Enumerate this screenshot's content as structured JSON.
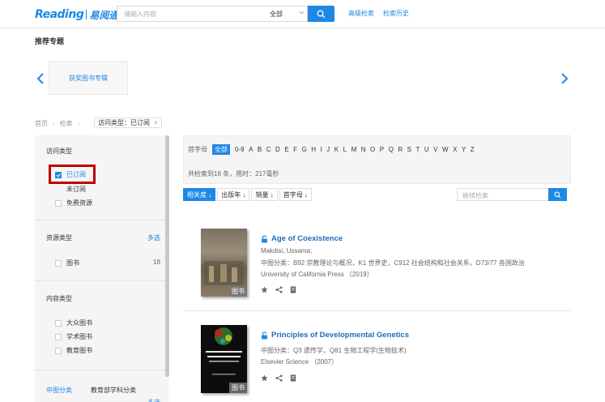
{
  "header": {
    "logo_en": "Reading",
    "logo_cn": "易阅通",
    "search_placeholder": "请输入内容",
    "search_scope": "全部",
    "advanced_search": "高级检索",
    "search_history": "检索历史"
  },
  "featured": {
    "title": "推荐专题",
    "card_label": "获奖图书专辑"
  },
  "breadcrumb": {
    "home": "首页",
    "search": "检索",
    "filter_tag": "访问类型：已订阅"
  },
  "sidebar": {
    "access": {
      "title": "访问类型",
      "items": [
        {
          "label": "已订阅",
          "checked": true
        },
        {
          "label": "未订阅",
          "checked": false
        },
        {
          "label": "免费资源",
          "checked": false
        }
      ]
    },
    "resource": {
      "title": "资源类型",
      "more": "多选",
      "items": [
        {
          "label": "图书",
          "count": "18"
        }
      ]
    },
    "content": {
      "title": "内容类型",
      "items": [
        {
          "label": "大众图书"
        },
        {
          "label": "学术图书"
        },
        {
          "label": "教育图书"
        }
      ]
    },
    "bottom_tabs": [
      "中图分类",
      "教育部学科分类"
    ],
    "bottom_more": "多选"
  },
  "letters": {
    "label": "首字母",
    "items": [
      "全部",
      "0-9",
      "A",
      "B",
      "C",
      "D",
      "E",
      "F",
      "G",
      "H",
      "I",
      "J",
      "K",
      "L",
      "M",
      "N",
      "O",
      "P",
      "Q",
      "R",
      "S",
      "T",
      "U",
      "V",
      "W",
      "X",
      "Y",
      "Z"
    ],
    "active": "全部"
  },
  "stats": "共检索到18 条，用时：217毫秒",
  "sort": {
    "options": [
      "相关度 ↓",
      "出版年 ↓",
      "销量 ↓",
      "首字母 ↓"
    ],
    "active_index": 0,
    "within_placeholder": "继续检索"
  },
  "results": [
    {
      "title": "Age of Coexistence",
      "author": "Makdisi, Ussama;",
      "classification": "中图分类：B92 宗教理论与概况，K1 世界史，C912 社会结构和社会关系，D73/77 各国政治",
      "publisher": "University of California Press （2019）",
      "badge": "图书",
      "cover_text": "Age of Coexistence"
    },
    {
      "title": "Principles of Developmental Genetics",
      "classification": "中图分类：Q3 遗传学，Q81 生物工程学(生物技术)",
      "publisher": "Elsevier Science （2007）",
      "badge": "图书",
      "cover_text": "Principles of Developmental Genetics"
    }
  ],
  "colors": {
    "accent": "#1e88e5",
    "highlight": "#c00000"
  }
}
